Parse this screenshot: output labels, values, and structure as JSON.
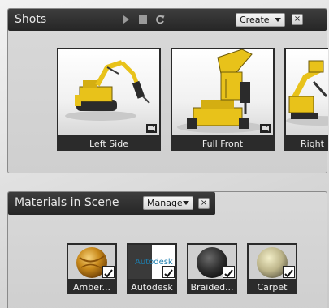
{
  "shots": {
    "title": "Shots",
    "create_label": "Create",
    "close_label": "×",
    "cards": [
      {
        "label": "Left Side"
      },
      {
        "label": "Full Front"
      },
      {
        "label": "Right"
      }
    ]
  },
  "materials": {
    "title": "Materials in Scene",
    "manage_label": "Manage",
    "close_label": "×",
    "swatches": [
      {
        "label": "Amber...",
        "checked": true
      },
      {
        "label": "Autodesk",
        "thumb_text": "Autodesk",
        "checked": true
      },
      {
        "label": "Braided...",
        "checked": true
      },
      {
        "label": "Carpet",
        "checked": true
      }
    ]
  },
  "colors": {
    "title_bar": "#2e2e2e",
    "machine_yellow": "#e8c21a",
    "label_bg": "#2b2b2b"
  }
}
